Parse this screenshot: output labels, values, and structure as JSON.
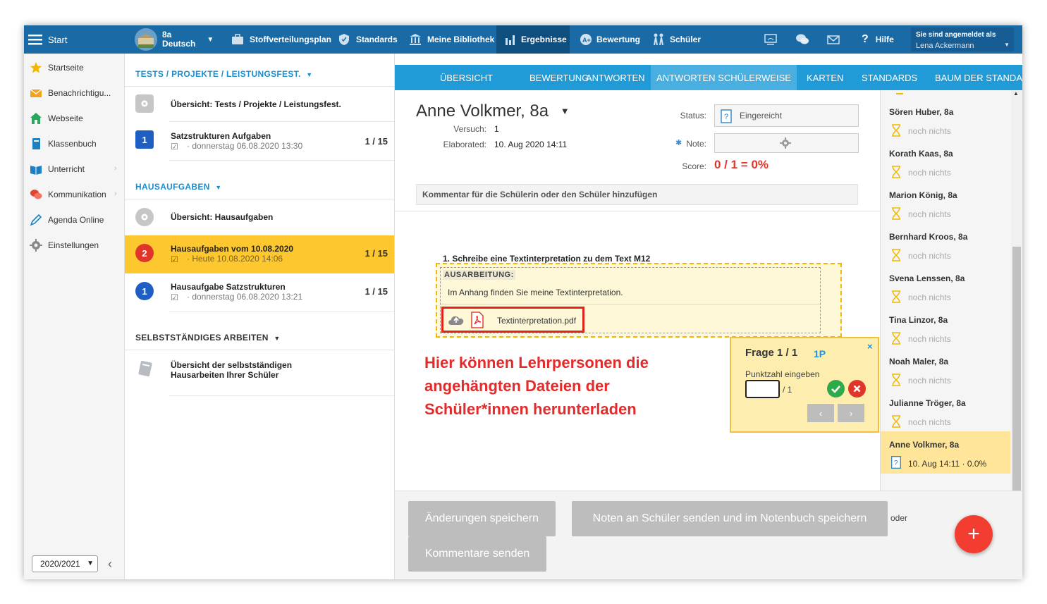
{
  "topbar": {
    "start": "Start",
    "class_line1": "8a",
    "class_line2": "Deutsch",
    "nav": [
      "Stoffverteilungsplan",
      "Standards",
      "Meine Bibliothek",
      "Ergebnisse",
      "Bewertung",
      "Schüler"
    ],
    "help": "Hilfe",
    "login_label": "Sie sind angemeldet als",
    "login_user": "Lena Ackermann"
  },
  "sidebar": {
    "items": [
      "Startseite",
      "Benachrichtigu...",
      "Webseite",
      "Klassenbuch",
      "Unterricht",
      "Kommunikation",
      "Agenda Online",
      "Einstellungen"
    ],
    "year": "2020/2021"
  },
  "middle": {
    "section1": "TESTS / PROJEKTE / LEISTUNGSFEST.",
    "s1_overview": "Übersicht: Tests / Projekte / Leistungsfest.",
    "s1_item_badge": "1",
    "s1_item_title": "Satzstrukturen Aufgaben",
    "s1_item_date": "· donnerstag 06.08.2020 13:30",
    "s1_item_count": "1 / 15",
    "section2": "HAUSAUFGABEN",
    "s2_overview": "Übersicht: Hausaufgaben",
    "s2_item1_badge": "2",
    "s2_item1_title": "Hausaufgaben vom 10.08.2020",
    "s2_item1_date": "· Heute 10.08.2020 14:06",
    "s2_item1_count": "1 / 15",
    "s2_item2_badge": "1",
    "s2_item2_title": "Hausaufgabe Satzstrukturen",
    "s2_item2_date": "· donnerstag 06.08.2020 13:21",
    "s2_item2_count": "1 / 15",
    "section3": "SELBSTSTÄNDIGES ARBEITEN",
    "s3_line1": "Übersicht der selbstständigen",
    "s3_line2": "Hausarbeiten Ihrer Schüler"
  },
  "tabs": [
    "ÜBERSICHT",
    "BEWERTUNG",
    "ANTWORTEN",
    "ANTWORTEN SCHÜLERWEISE",
    "KARTEN",
    "STANDARDS",
    "BAUM DER STANDAR"
  ],
  "main": {
    "student_name": "Anne Volkmer, 8a",
    "versuch_label": "Versuch:",
    "versuch_value": "1",
    "elaborated_label": "Elaborated:",
    "elaborated_value": "10. Aug 2020 14:11",
    "status_label": "Status:",
    "status_value": "Eingereicht",
    "note_label": "Note:",
    "score_label": "Score:",
    "score_value": "0 / 1 = 0%",
    "comment_placeholder": "Kommentar für die Schülerin oder den Schüler hinzufügen",
    "question": "1.  Schreibe eine Textinterpretation zu dem Text M12",
    "answer_label": "AUSARBEITUNG:",
    "answer_text": "Im Anhang finden Sie meine Textinterpretation.",
    "attachment": "Textinterpretation.pdf",
    "annotation": "Hier können Lehrpersonen die angehängten Dateien der Schüler*innen herunterladen"
  },
  "popup": {
    "title": "Frage 1 / 1",
    "points": "1P",
    "label": "Punktzahl eingeben",
    "max": "/ 1"
  },
  "students": [
    {
      "name": "Sören Huber, 8a",
      "status": "noch nichts"
    },
    {
      "name": "Korath Kaas, 8a",
      "status": "noch nichts"
    },
    {
      "name": "Marion König, 8a",
      "status": "noch nichts"
    },
    {
      "name": "Bernhard Kroos, 8a",
      "status": "noch nichts"
    },
    {
      "name": "Svena Lenssen, 8a",
      "status": "noch nichts"
    },
    {
      "name": "Tina Linzor, 8a",
      "status": "noch nichts"
    },
    {
      "name": "Noah Maler, 8a",
      "status": "noch nichts"
    },
    {
      "name": "Julianne Tröger, 8a",
      "status": "noch nichts"
    },
    {
      "name": "Anne Volkmer, 8a",
      "status": "10. Aug 14:11 · 0.0%"
    }
  ],
  "bottom": {
    "save": "Änderungen speichern",
    "send_grades": "Noten an Schüler senden und im Notenbuch speichern",
    "or": "oder",
    "send_comments": "Kommentare senden",
    "fab": "+"
  },
  "colors": {
    "topbar": "#1a6aa6",
    "tabs": "#219bd7",
    "highlight": "#fdc72f",
    "annotation_red": "#e32b2b"
  }
}
